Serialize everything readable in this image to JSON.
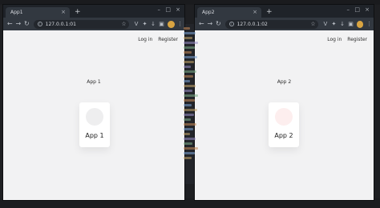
{
  "colors": {
    "app1_circle": "#eeeeef",
    "app2_circle": "#fdeeee"
  },
  "windows": [
    {
      "tab": {
        "title": "App1",
        "close_icon": "close-icon"
      },
      "url": "127.0.0.1:01",
      "nav": {
        "login": "Log in",
        "register": "Register"
      },
      "heading": "App 1",
      "card_label": "App 1"
    },
    {
      "tab": {
        "title": "App2",
        "close_icon": "close-icon"
      },
      "url": "127.0.0.1:02",
      "nav": {
        "login": "Log in",
        "register": "Register"
      },
      "heading": "App 2",
      "card_label": "App 2"
    }
  ]
}
